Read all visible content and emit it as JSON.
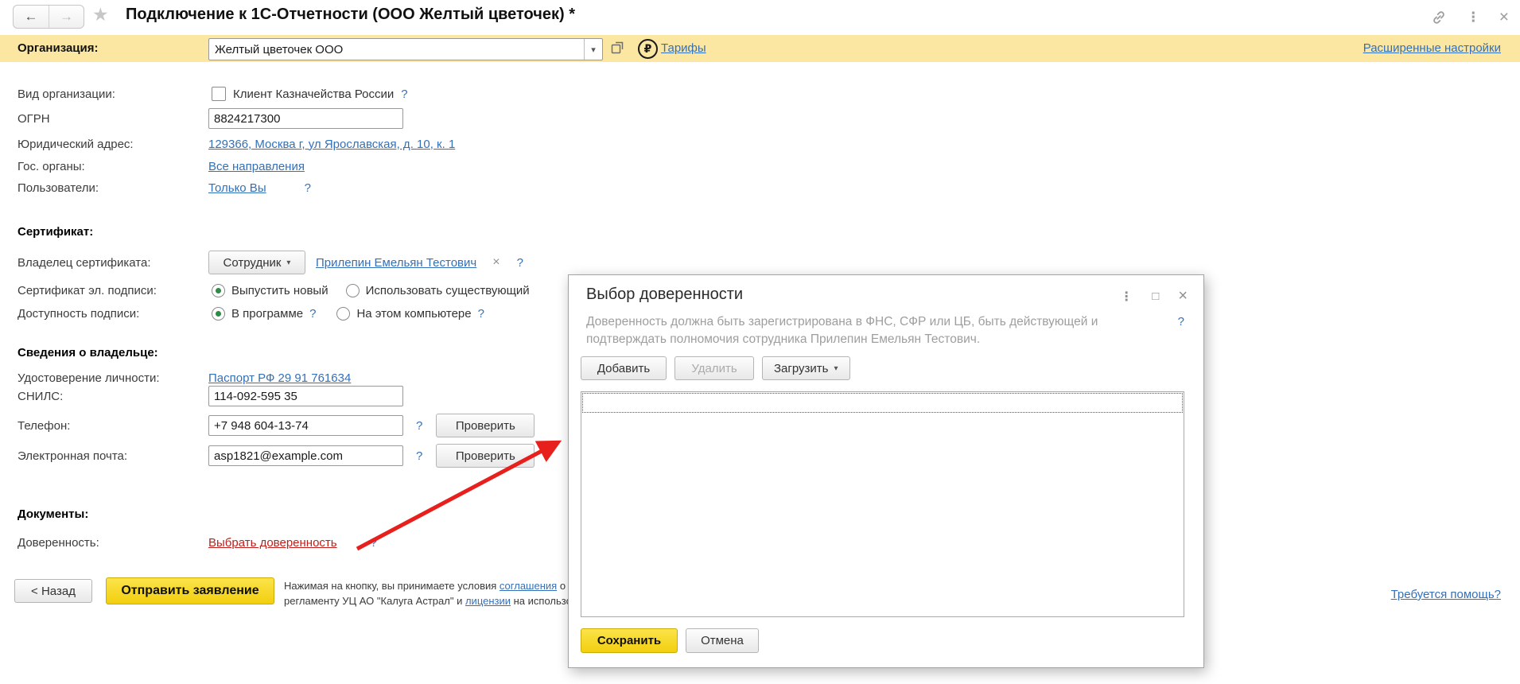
{
  "icons": {
    "back_arrow": "←",
    "forward_arrow": "→",
    "star": "★",
    "more_dots": "⋮",
    "close": "×",
    "maximize": "□",
    "dropdown_arrow": "▾",
    "ruble": "₽",
    "remove_x": "×",
    "help_mark": "?"
  },
  "header": {
    "title": "Подключение к 1С-Отчетности (ООО Желтый цветочек) *"
  },
  "org_bar": {
    "label": "Организация:",
    "value": "Желтый цветочек ООО",
    "tariffs_link": "Тарифы",
    "advanced_settings_link": "Расширенные настройки"
  },
  "form": {
    "org_type_label": "Вид организации:",
    "org_type_checkbox": "Клиент Казначейства России",
    "ogrn_label": "ОГРН",
    "ogrn_value": "8824217300",
    "address_label": "Юридический адрес:",
    "address_link": "129366, Москва г, ул Ярославская, д. 10, к. 1",
    "gov_label": "Гос. органы:",
    "gov_link": "Все направления",
    "users_label": "Пользователи:",
    "users_link": "Только Вы",
    "cert_section_title": "Сертификат:",
    "cert_owner_label": "Владелец сертификата:",
    "cert_owner_type": "Сотрудник",
    "cert_owner_link": "Прилепин Емельян Тестович",
    "cert_type_label": "Сертификат эл. подписи:",
    "cert_type_new": "Выпустить новый",
    "cert_type_existing": "Использовать существующий",
    "sign_access_label": "Доступность подписи:",
    "sign_access_program": "В программе",
    "sign_access_computer": "На этом компьютере",
    "owner_section_title": "Сведения о владельце:",
    "identity_label": "Удостоверение личности:",
    "identity_link": "Паспорт РФ 29 91 761634",
    "snils_label": "СНИЛС:",
    "snils_value": "114-092-595 35",
    "phone_label": "Телефон:",
    "phone_value": "+7 948 604-13-74",
    "phone_check_button": "Проверить",
    "email_label": "Электронная почта:",
    "email_value": "asp1821@example.com",
    "email_check_button": "Проверить",
    "docs_section_title": "Документы:",
    "poa_label": "Доверенность:",
    "poa_link": "Выбрать доверенность"
  },
  "footer": {
    "back_button": "< Назад",
    "submit_button": "Отправить заявление",
    "agreement_text_1": "Нажимая на кнопку, вы принимаете условия ",
    "agreement_link_1": "соглашения",
    "agreement_text_2": " о п",
    "agreement_text_3": "регламенту УЦ АО \"Калуга Астрал\" и ",
    "agreement_link_2": "лицензии",
    "agreement_text_4": " на использова",
    "help_link": "Требуется помощь?"
  },
  "dialog": {
    "title": "Выбор доверенности",
    "description": "Доверенность должна быть зарегистрирована в ФНС, СФР или ЦБ, быть действующей и подтверждать полномочия сотрудника Прилепин Емельян Тестович.",
    "add_button": "Добавить",
    "delete_button": "Удалить",
    "load_button": "Загрузить",
    "save_button": "Сохранить",
    "cancel_button": "Отмена"
  },
  "colors": {
    "accent_yellow": "#fbe7a2",
    "button_yellow": "#f4d411",
    "link_blue": "#3470b8",
    "alert_red": "#bf1f1a",
    "arrow_red": "#e8201d",
    "radio_green": "#2e8b46"
  }
}
